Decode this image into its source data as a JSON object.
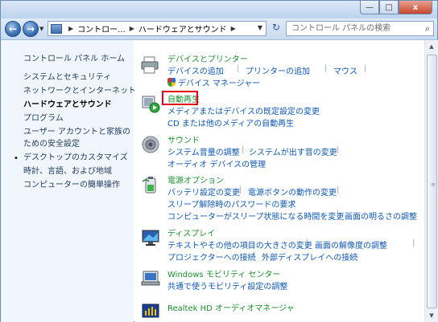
{
  "window": {
    "controls": {
      "minimize": "—",
      "maximize": "□",
      "close": "x"
    }
  },
  "navbar": {
    "back": "←",
    "forward": "→",
    "breadcrumb": [
      "コントロー...",
      "ハードウェアとサウンド"
    ],
    "refresh": "↻",
    "search_placeholder": "コントロール パネルの検索"
  },
  "sidebar": {
    "items": [
      {
        "label": "コントロール パネル ホーム"
      },
      {
        "label": "システムとセキュリティ"
      },
      {
        "label": "ネットワークとインターネット"
      },
      {
        "label": "ハードウェアとサウンド"
      },
      {
        "label": "プログラム"
      },
      {
        "label": "ユーザー アカウントと家族の"
      },
      {
        "label": "ための安全設定"
      },
      {
        "label": "デスクトップのカスタマイズ"
      },
      {
        "label": "時計、言語、および地域"
      },
      {
        "label": "コンピューターの簡単操作"
      }
    ]
  },
  "categories": [
    {
      "title": "デバイスとプリンター",
      "links": [
        "デバイスの追加",
        "プリンターの追加",
        "マウス",
        "デバイス マネージャー"
      ]
    },
    {
      "title": "自動再生",
      "links": [
        "メディアまたはデバイスの既定設定の変更",
        "CD または他のメディアの自動再生"
      ]
    },
    {
      "title": "サウンド",
      "links": [
        "システム音量の調整",
        "システムが出す音の変更",
        "オーディオ デバイスの管理"
      ]
    },
    {
      "title": "電源オプション",
      "links": [
        "バッテリ設定の変更",
        "電源ボタンの動作の変更",
        "スリープ解除時のパスワードの要求",
        "コンピューターがスリープ状態になる時間を変更",
        "画面の明るさの調整"
      ]
    },
    {
      "title": "ディスプレイ",
      "links": [
        "テキストやその他の項目の大きさの変更",
        "画面の解像度の調整",
        "プロジェクターへの接続",
        "外部ディスプレイへの接続"
      ]
    },
    {
      "title": "Windows モビリティ センター",
      "links": [
        "共通で使うモビリティ設定の調整"
      ]
    },
    {
      "title": "Realtek HD オーディオマネージャ",
      "links": []
    }
  ],
  "colors": {
    "accent_green": "#1a8e2d",
    "link_blue": "#0e58b4",
    "highlight_red": "#e3001b"
  }
}
